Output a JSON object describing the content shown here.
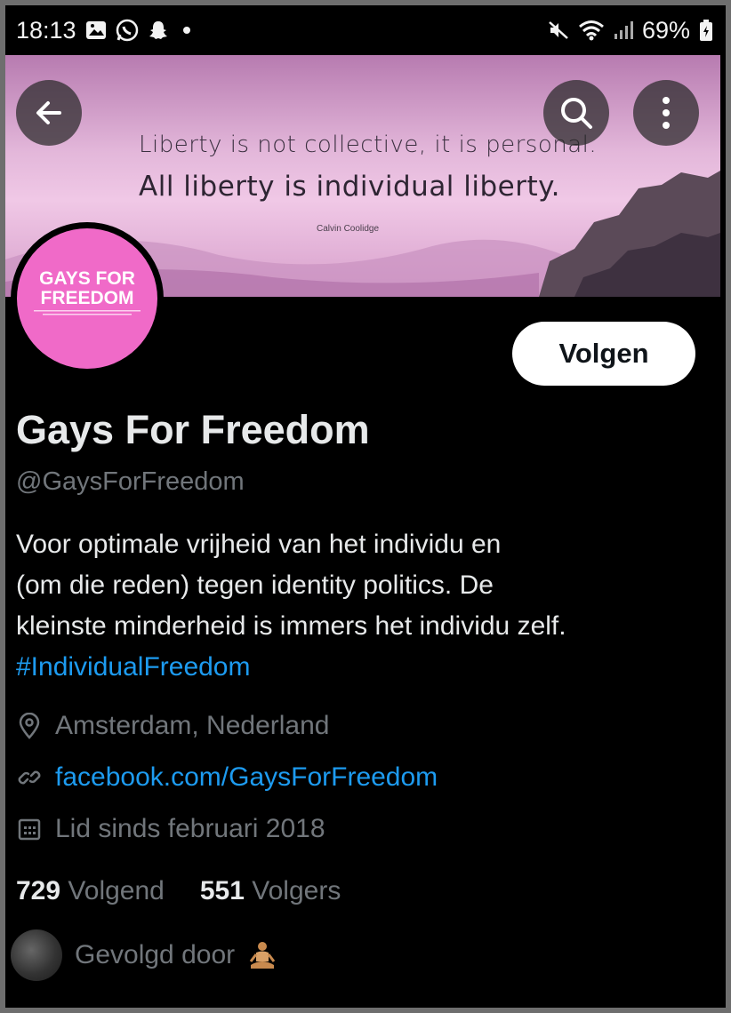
{
  "status_bar": {
    "time": "18:13",
    "battery": "69%"
  },
  "banner": {
    "quote_line1": "Liberty is not collective, it is personal.",
    "quote_line2": "All liberty is individual liberty.",
    "quote_author": "Calvin Coolidge"
  },
  "avatar": {
    "line1": "GAYS FOR",
    "line2": "FREEDOM",
    "color": "#f06ac8"
  },
  "follow_button": {
    "label": "Volgen"
  },
  "profile": {
    "name": "Gays For Freedom",
    "handle": "@GaysForFreedom",
    "bio_lines": [
      "Voor optimale vrijheid van het individu en",
      "(om die reden) tegen identity politics. De",
      "kleinste minderheid is immers het individu zelf."
    ],
    "hashtag": "#IndividualFreedom",
    "location": "Amsterdam, Nederland",
    "link": "facebook.com/GaysForFreedom",
    "joined": "Lid sinds februari 2018"
  },
  "counts": {
    "following_num": "729",
    "following_label": "Volgend",
    "followers_num": "551",
    "followers_label": "Volgers"
  },
  "followed_by": {
    "label": "Gevolgd door"
  },
  "colors": {
    "background": "#000000",
    "text": "#e7e9ea",
    "secondary": "#71767b",
    "link": "#1d9bf0"
  }
}
